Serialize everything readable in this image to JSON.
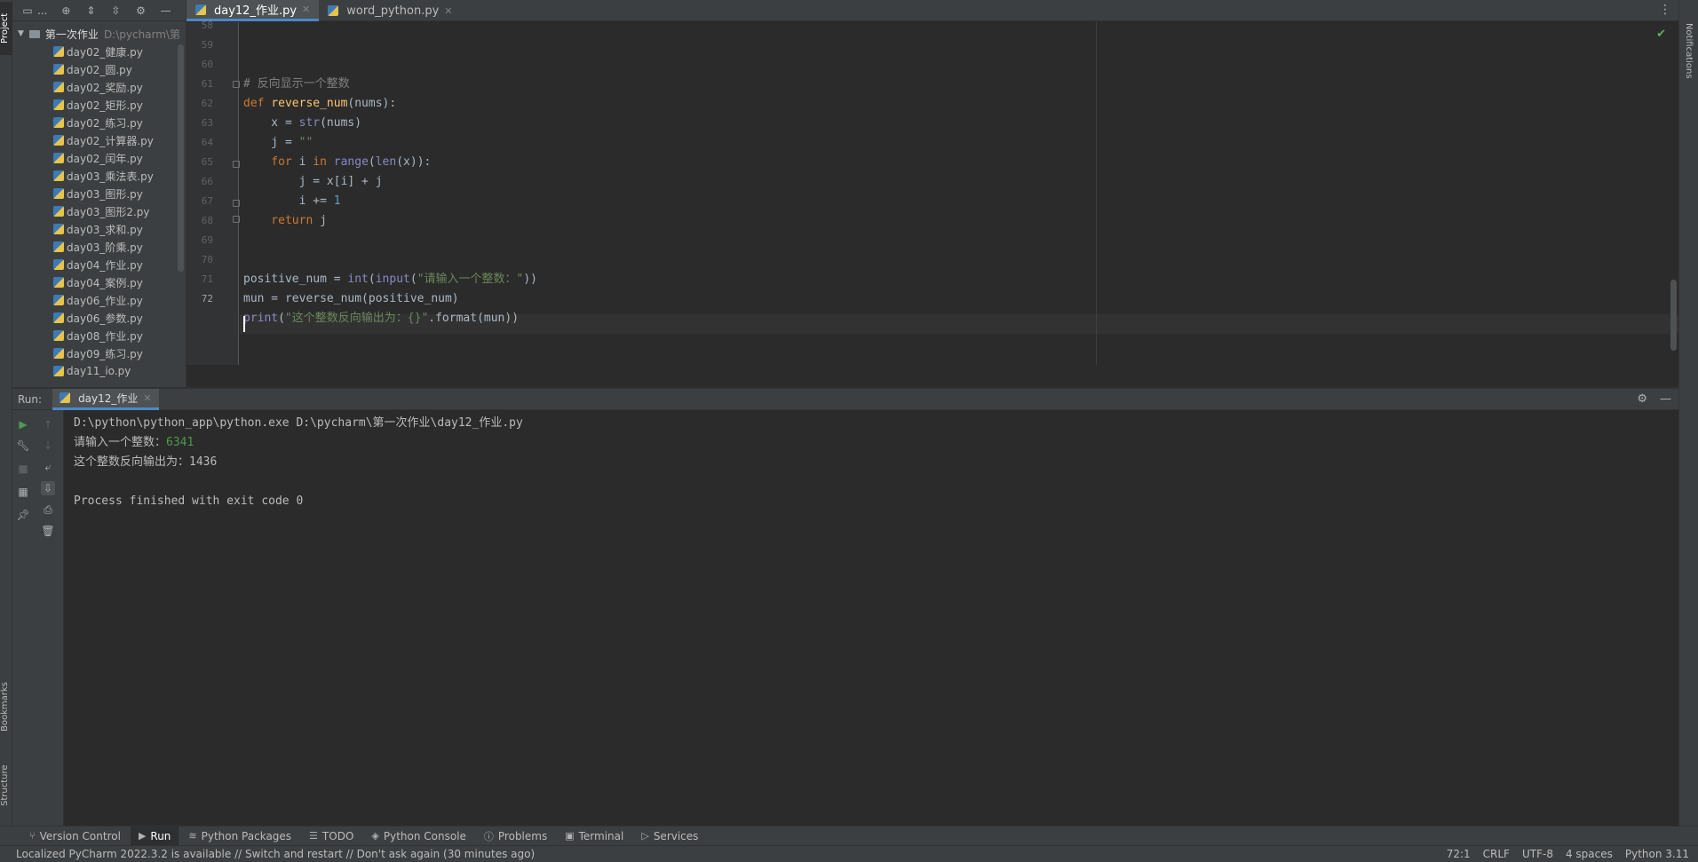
{
  "left_stripe": {
    "project_label": "Project",
    "bookmarks_label": "Bookmarks",
    "structure_label": "Structure"
  },
  "right_stripe": {
    "notifications_label": "Notifications"
  },
  "project": {
    "toolbar_title": "...",
    "root_name": "第一次作业",
    "root_path": "D:\\pycharm\\第",
    "files": [
      "day02_健康.py",
      "day02_圆.py",
      "day02_奖励.py",
      "day02_矩形.py",
      "day02_练习.py",
      "day02_计算器.py",
      "day02_闰年.py",
      "day03_乘法表.py",
      "day03_图形.py",
      "day03_图形2.py",
      "day03_求和.py",
      "day03_阶乘.py",
      "day04_作业.py",
      "day04_案例.py",
      "day06_作业.py",
      "day06_参数.py",
      "day08_作业.py",
      "day09_练习.py",
      "day11_io.py"
    ]
  },
  "tabs": [
    {
      "label": "day12_作业.py",
      "active": true
    },
    {
      "label": "word_python.py",
      "active": false
    }
  ],
  "editor": {
    "line_numbers": [
      "58",
      "59",
      "60",
      "61",
      "62",
      "63",
      "64",
      "65",
      "66",
      "67",
      "68",
      "69",
      "70",
      "71",
      "72"
    ],
    "current_line": "72",
    "lines": {
      "l59_comment": "# 反向显示一个整数",
      "l60_def": "def",
      "l60_name": "reverse_num",
      "l60_rest": "(nums):",
      "l61_a": "    x = ",
      "l61_str": "str",
      "l61_b": "(nums)",
      "l62_a": "    j = ",
      "l62_str": "\"\"",
      "l63_for": "    for",
      "l63_a": " i ",
      "l63_in": "in",
      "l63_sp": " ",
      "l63_range": "range",
      "l63_b": "(",
      "l63_len": "len",
      "l63_c": "(x)):",
      "l64": "        j = x[i] + j",
      "l65_a": "        i += ",
      "l65_num": "1",
      "l66_return": "    return",
      "l66_b": " j",
      "l69_a": "positive_num = ",
      "l69_int": "int",
      "l69_b": "(",
      "l69_input": "input",
      "l69_c": "(",
      "l69_str": "\"请输入一个整数：\"",
      "l69_d": "))",
      "l70": "mun = reverse_num(positive_num)",
      "l71_print": "print",
      "l71_b": "(",
      "l71_str": "\"这个整数反向输出为：{}\"",
      "l71_c": ".format(mun))"
    }
  },
  "run": {
    "label": "Run:",
    "tab_label": "day12_作业",
    "console": {
      "command": "D:\\python\\python_app\\python.exe D:\\pycharm\\第一次作业\\day12_作业.py",
      "prompt": "请输入一个整数：",
      "input_value": "6341",
      "output": "这个整数反向输出为：1436",
      "finished": "Process finished with exit code 0"
    }
  },
  "bottom_tools": [
    {
      "label": "Version Control",
      "icon": "branch-icon"
    },
    {
      "label": "Run",
      "icon": "play-icon",
      "active": true
    },
    {
      "label": "Python Packages",
      "icon": "layers-icon"
    },
    {
      "label": "TODO",
      "icon": "list-icon"
    },
    {
      "label": "Python Console",
      "icon": "python-icon"
    },
    {
      "label": "Problems",
      "icon": "info-icon"
    },
    {
      "label": "Terminal",
      "icon": "terminal-icon"
    },
    {
      "label": "Services",
      "icon": "services-icon"
    }
  ],
  "status": {
    "message": "Localized PyCharm 2022.3.2 is available // Switch and restart // Don't ask again (30 minutes ago)",
    "position": "72:1",
    "line_sep": "CRLF",
    "encoding": "UTF-8",
    "indent": "4 spaces",
    "interpreter": "Python 3.11"
  },
  "colors": {
    "background": "#2b2b2b",
    "panel": "#3c3f41",
    "accent": "#4a88c7",
    "keyword": "#cc7832",
    "string": "#6a8759",
    "number": "#6897bb",
    "function": "#ffc66d",
    "builtin": "#8888c6"
  }
}
